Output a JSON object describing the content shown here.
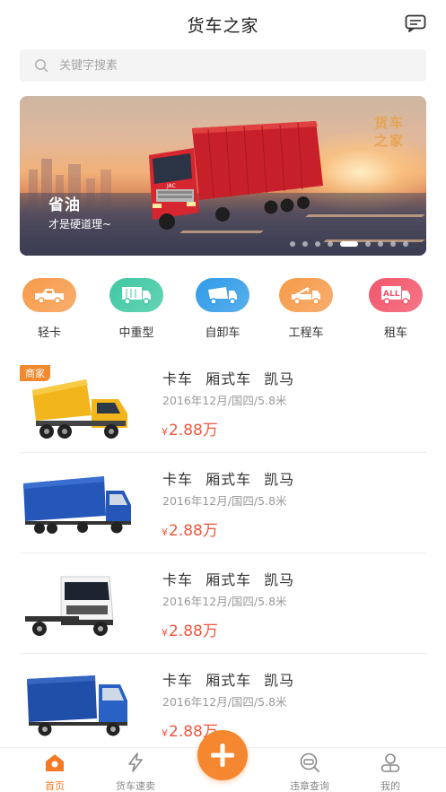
{
  "app": {
    "title": "货车之家"
  },
  "header": {
    "message_icon": "message-icon"
  },
  "search": {
    "placeholder": "关键字搜素",
    "icon": "search-icon"
  },
  "banner": {
    "headline": "省油",
    "subline": "才是硬道理~",
    "brand_line1": "货车",
    "brand_line2": "之家",
    "truck_brand": "JAC",
    "slide_count": 9,
    "active_slide": 5
  },
  "categories": [
    {
      "label": "轻卡",
      "icon": "light-truck-icon",
      "color": "#f79a4a"
    },
    {
      "label": "中重型",
      "icon": "box-truck-icon",
      "color": "#3fc8a2"
    },
    {
      "label": "自卸车",
      "icon": "dump-truck-icon",
      "color": "#2f9be8"
    },
    {
      "label": "工程车",
      "icon": "crane-truck-icon",
      "color": "#f79a4a"
    },
    {
      "label": "租车",
      "icon": "rental-truck-icon",
      "color": "#f2556a"
    }
  ],
  "listings": [
    {
      "name": "卡车 厢式车 凯马",
      "meta": "2016年12月/国四/5.8米",
      "currency": "¥",
      "price": "2.88万",
      "tag": "商家",
      "image": "yellow-dump-truck"
    },
    {
      "name": "卡车 厢式车 凯马",
      "meta": "2016年12月/国四/5.8米",
      "currency": "¥",
      "price": "2.88万",
      "tag": "",
      "image": "blue-box-truck"
    },
    {
      "name": "卡车 厢式车 凯马",
      "meta": "2016年12月/国四/5.8米",
      "currency": "¥",
      "price": "2.88万",
      "tag": "",
      "image": "white-tractor-truck"
    },
    {
      "name": "卡车 厢式车 凯马",
      "meta": "2016年12月/国四/5.8米",
      "currency": "¥",
      "price": "2.88万",
      "tag": "",
      "image": "blue-cargo-truck"
    }
  ],
  "tabbar": {
    "home": "首页",
    "sell": "货车速卖",
    "violation": "违章查询",
    "mine": "我的",
    "post_icon": "plus-icon"
  },
  "colors": {
    "accent": "#f27a25",
    "price": "#f2553c",
    "tag": "#f18a2e"
  }
}
